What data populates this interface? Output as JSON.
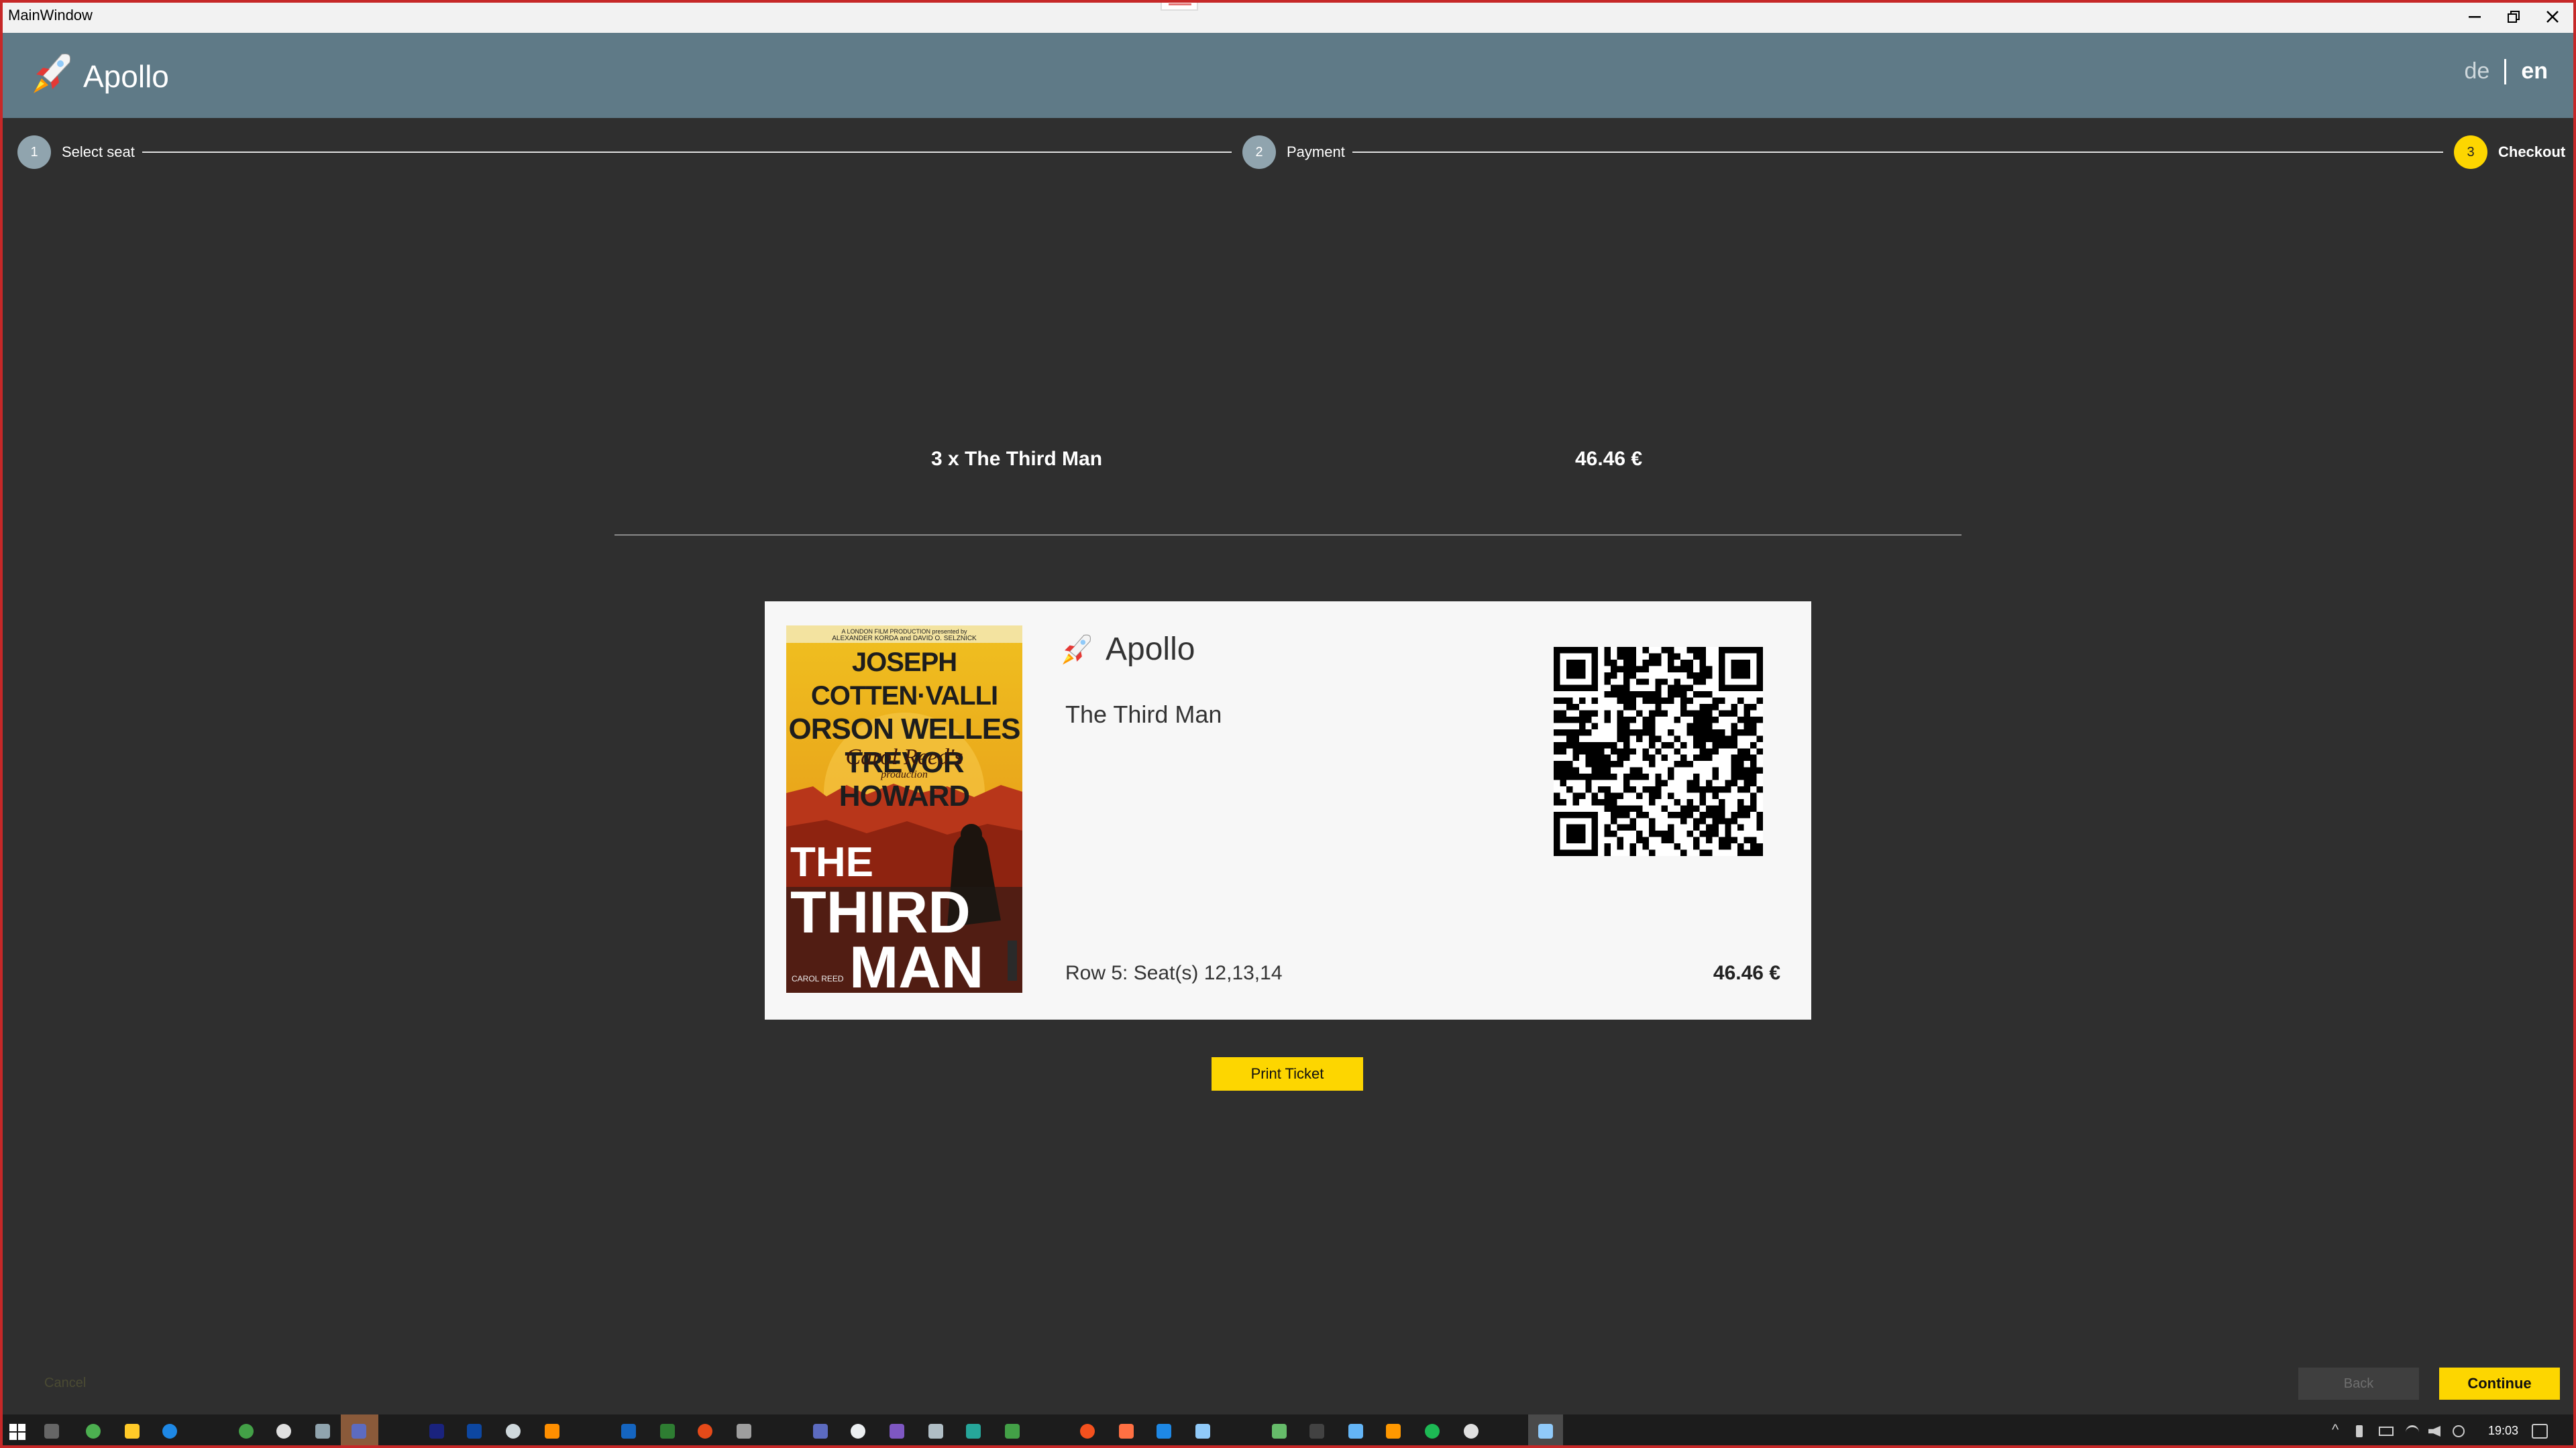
{
  "window": {
    "title": "MainWindow"
  },
  "app": {
    "name": "Apollo",
    "languages": {
      "de": "de",
      "en": "en",
      "active": "en"
    }
  },
  "steps": [
    {
      "number": "1",
      "label": "Select seat"
    },
    {
      "number": "2",
      "label": "Payment"
    },
    {
      "number": "3",
      "label": "Checkout"
    }
  ],
  "summary": {
    "item": "3 x The Third Man",
    "price": "46.46 €"
  },
  "ticket": {
    "brand": "Apollo",
    "movie": "The Third Man",
    "seats": "Row 5: Seat(s) 12,13,14",
    "price": "46.46 €",
    "poster": {
      "top_line": "A LONDON FILM PRODUCTION presented by",
      "top_line2": "ALEXANDER KORDA and DAVID O. SELZNICK",
      "cast": [
        "JOSEPH COTTEN·VALLI",
        "ORSON WELLES",
        "TREVOR HOWARD"
      ],
      "script": "Carol Reed's",
      "production": "production",
      "title1": "THE",
      "title2": "THIRD",
      "title3": "MAN",
      "credit": "CAROL REED"
    }
  },
  "actions": {
    "print": "Print Ticket",
    "cancel": "Cancel",
    "back": "Back",
    "continue": "Continue"
  },
  "taskbar": {
    "time": "19:03"
  },
  "colors": {
    "accent": "#fdd600",
    "header": "#5f7a87",
    "background": "#2f2f2f",
    "step_inactive": "#90a4ae"
  }
}
